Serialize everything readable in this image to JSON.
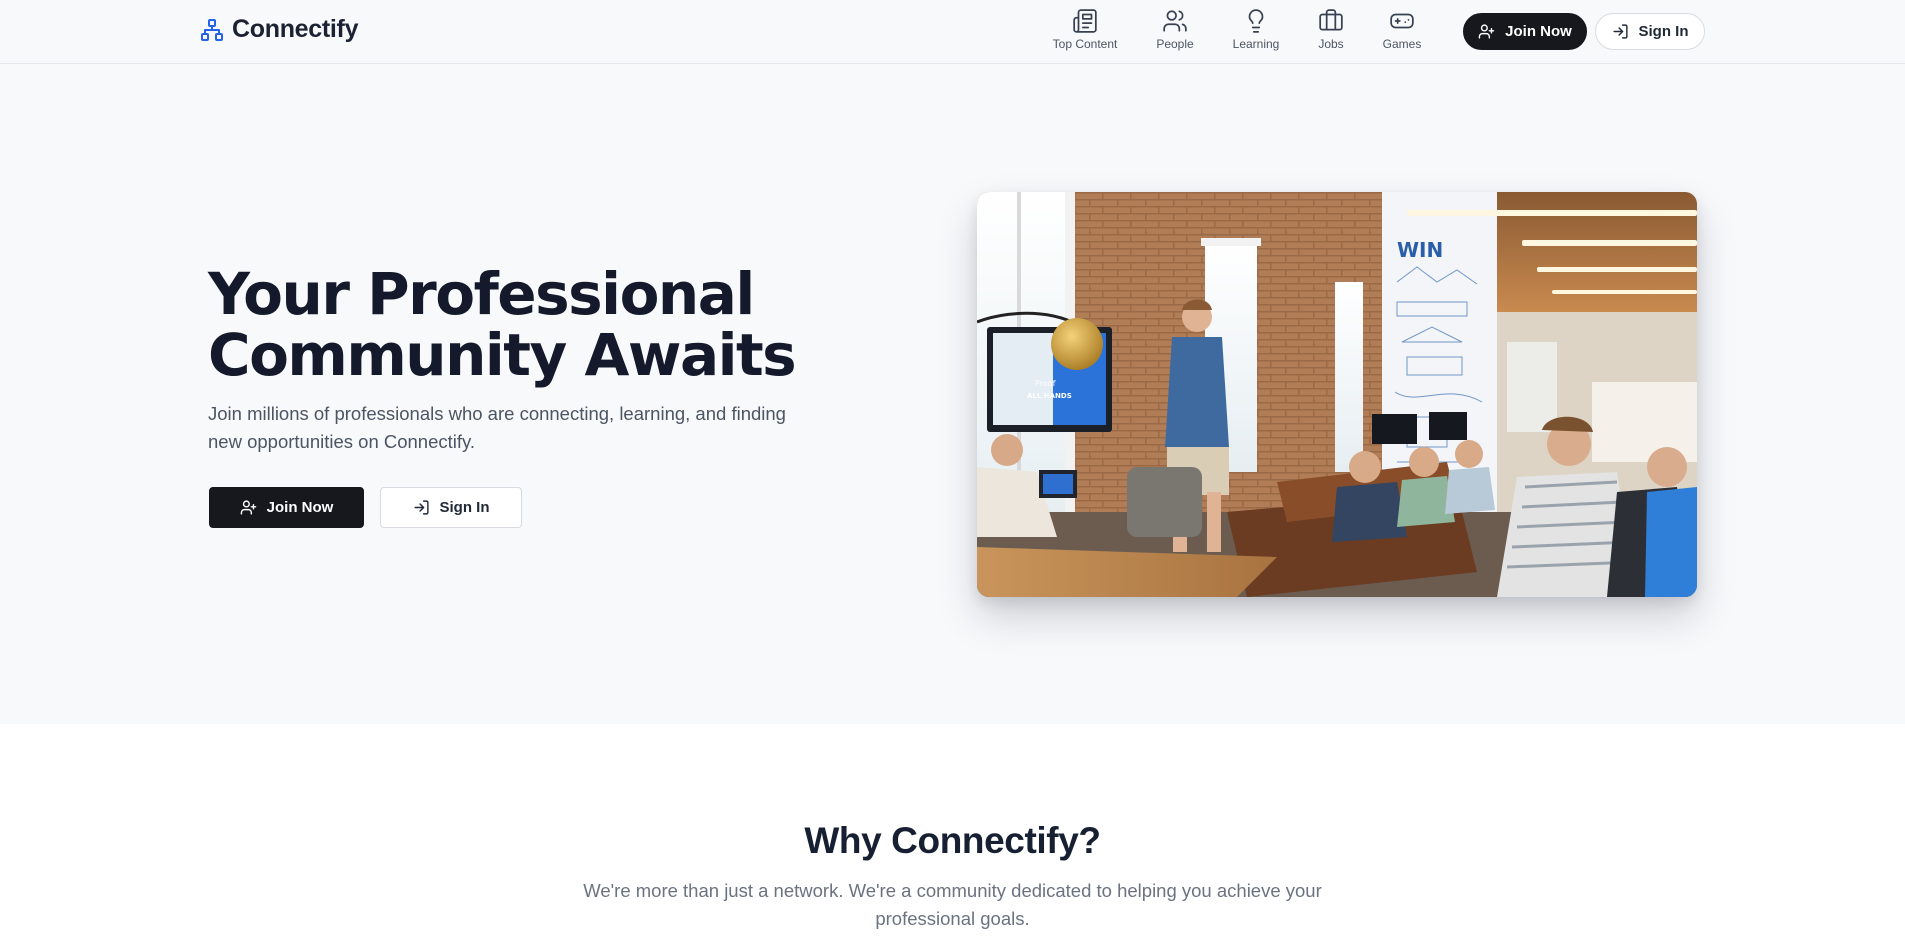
{
  "brand": {
    "name": "Connectify",
    "icon": "network-icon"
  },
  "nav": [
    {
      "label": "Top Content",
      "icon": "newspaper-icon"
    },
    {
      "label": "People",
      "icon": "users-icon"
    },
    {
      "label": "Learning",
      "icon": "lightbulb-icon"
    },
    {
      "label": "Jobs",
      "icon": "briefcase-icon"
    },
    {
      "label": "Games",
      "icon": "gamepad-icon"
    }
  ],
  "header_actions": {
    "join_label": "Join Now",
    "join_icon": "user-plus-icon",
    "sign_in_label": "Sign In",
    "sign_in_icon": "log-in-icon"
  },
  "hero": {
    "title_line1": "Your Professional",
    "title_line2": "Community Awaits",
    "subtitle": "Join millions of professionals who are connecting, learning, and finding new opportunities on Connectify.",
    "join_label": "Join Now",
    "sign_in_label": "Sign In",
    "image_alt": "Team meeting in a brick-walled office with a presenter standing by a screen",
    "screen_text_1": "Proof",
    "screen_text_2": "ALL HANDS",
    "wall_text": "WIN"
  },
  "why": {
    "title": "Why Connectify?",
    "subtitle": "We're more than just a network. We're a community dedicated to helping you achieve your professional goals."
  },
  "colors": {
    "brand_icon": "#2563eb",
    "primary_button": "#16181d",
    "page_background": "#f8f9fb",
    "heading": "#141a2b"
  }
}
